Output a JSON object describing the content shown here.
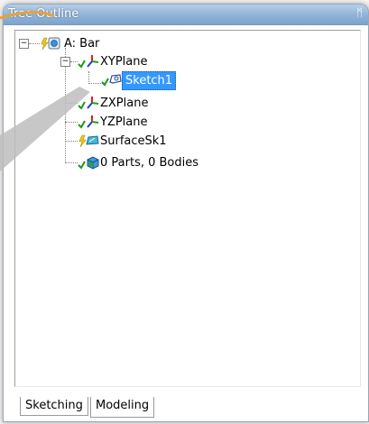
{
  "window": {
    "title": "Tree Outline",
    "pin_icon": "pin-icon"
  },
  "tree": {
    "root_label": "A: Bar",
    "items": [
      {
        "label": "XYPlane",
        "icon": "plane-axes-icon"
      },
      {
        "label": "Sketch1",
        "icon": "sketch-icon",
        "selected": true
      },
      {
        "label": "ZXPlane",
        "icon": "plane-axes-icon"
      },
      {
        "label": "YZPlane",
        "icon": "plane-axes-icon"
      },
      {
        "label": "SurfaceSk1",
        "icon": "surface-sketch-icon"
      },
      {
        "label": "0 Parts, 0 Bodies",
        "icon": "parts-icon"
      }
    ]
  },
  "tabs": [
    {
      "label": "Sketching",
      "active": false
    },
    {
      "label": "Modeling",
      "active": true
    }
  ],
  "colors": {
    "selection": "#3399ff",
    "check": "#1a9a1a",
    "axis_red": "#e02020",
    "axis_green": "#20a020",
    "axis_blue": "#2040d0"
  }
}
